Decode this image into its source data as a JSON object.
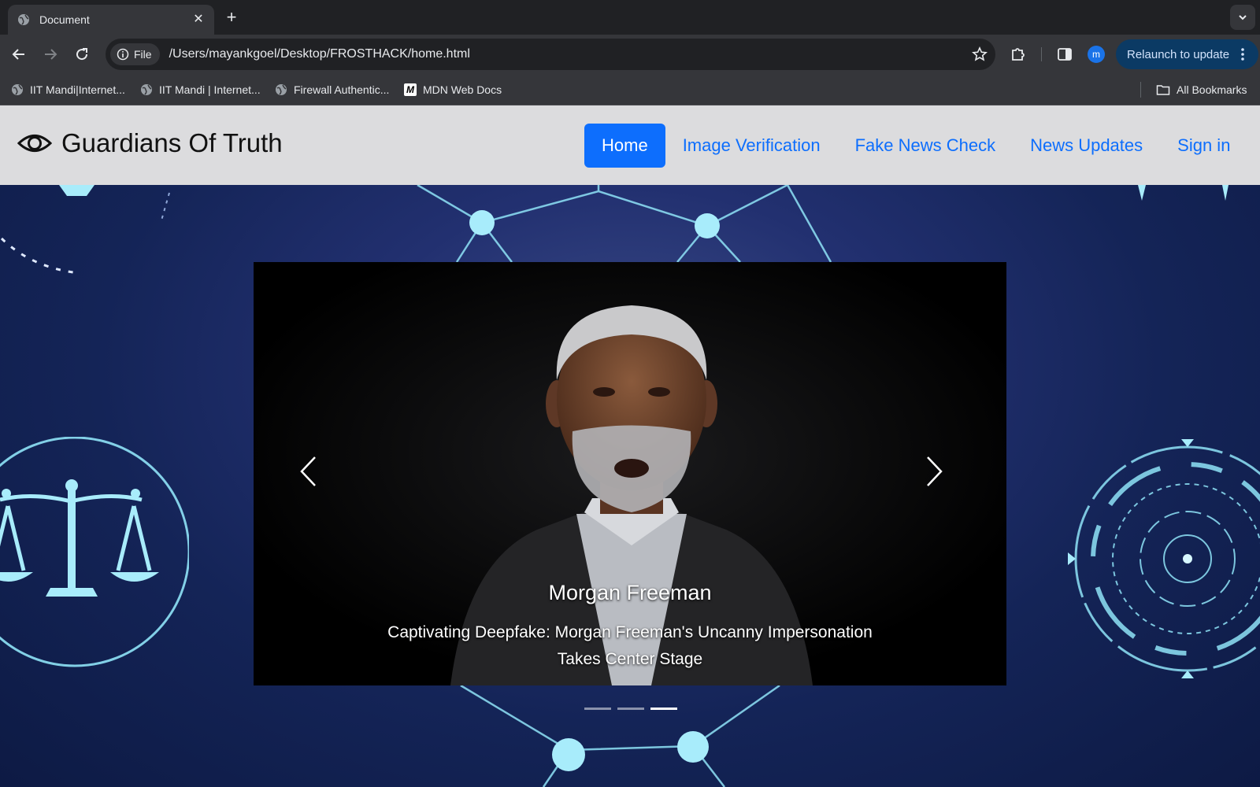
{
  "browser": {
    "tab": {
      "title": "Document",
      "close_glyph": "✕"
    },
    "new_tab_glyph": "+",
    "omnibox": {
      "chip_label": "File",
      "url": "/Users/mayankgoel/Desktop/FROSTHACK/home.html"
    },
    "profile_initial": "m",
    "relaunch_label": "Relaunch to update",
    "bookmarks": [
      {
        "label": "IIT Mandi|Internet...",
        "icon": "globe-icon"
      },
      {
        "label": "IIT Mandi | Internet...",
        "icon": "globe-icon"
      },
      {
        "label": "Firewall Authentic...",
        "icon": "globe-icon"
      },
      {
        "label": "MDN Web Docs",
        "icon": "mdn-icon",
        "glyph": "M"
      }
    ],
    "all_bookmarks_label": "All Bookmarks"
  },
  "site": {
    "brand": {
      "title": "Guardians Of Truth",
      "icon": "eye-icon"
    },
    "nav": [
      {
        "label": "Home",
        "active": true
      },
      {
        "label": "Image Verification",
        "active": false
      },
      {
        "label": "Fake News Check",
        "active": false
      },
      {
        "label": "News Updates",
        "active": false
      },
      {
        "label": "Sign in",
        "active": false
      }
    ],
    "carousel": {
      "caption_title": "Morgan Freeman",
      "caption_text_line1": "Captivating Deepfake: Morgan Freeman's Uncanny Impersonation",
      "caption_text_line2": "Takes Center Stage",
      "slide_count": 3,
      "active_slide": 3
    }
  },
  "colors": {
    "accent": "#0d6efd",
    "hero_background": "#142457",
    "glow": "#8fe3f7"
  }
}
